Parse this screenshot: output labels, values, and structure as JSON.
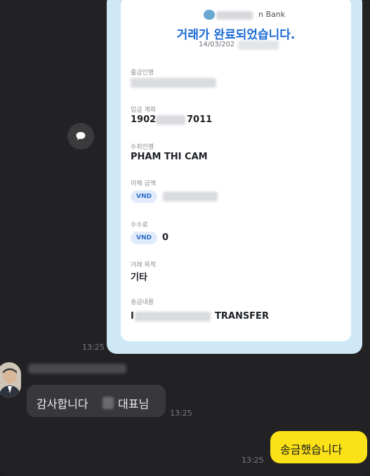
{
  "receipt": {
    "bank_name": "n Bank",
    "title": "거래가 완료되었습니다.",
    "date": "14/03/202",
    "fields": {
      "sender_label": "출금인명",
      "account_label": "입금 계좌",
      "account_prefix": "1902",
      "account_suffix": "7011",
      "recipient_label": "수취인명",
      "recipient_value": "PHAM THI CAM",
      "amount_label": "이체 금액",
      "amount_currency": "VND",
      "fee_label": "수수료",
      "fee_currency": "VND",
      "fee_value": "0",
      "purpose_label": "거래 목적",
      "purpose_value": "기타",
      "memo_label": "송금내용",
      "memo_prefix": "I",
      "memo_suffix": "TRANSFER"
    }
  },
  "messages": {
    "image_time": "13:25",
    "received_text_part1": "감사합니다",
    "received_text_part2": "대표님",
    "received_time": "13:25",
    "sent_text": "송금했습니다",
    "sent_time": "13:25"
  },
  "colors": {
    "background": "#222224",
    "sent_bubble": "#fbe118",
    "received_bubble": "#38383b",
    "title_blue": "#1a6ad6"
  }
}
